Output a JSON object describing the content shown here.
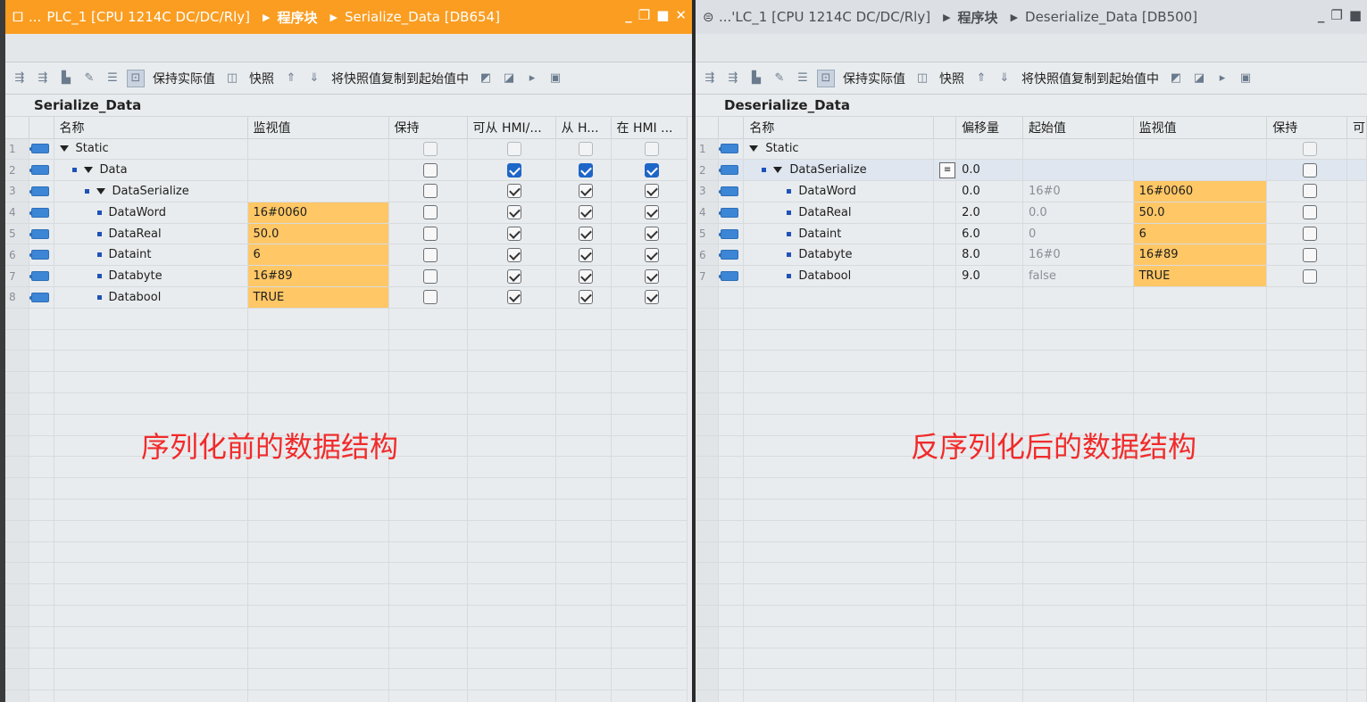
{
  "left": {
    "title": {
      "pin": "🞐",
      "ellipsis": "...",
      "device": "PLC_1 [CPU 1214C DC/DC/Rly]",
      "section": "程序块",
      "block": "Serialize_Data [DB654]",
      "controls": [
        "_",
        "❐",
        "■",
        "✕"
      ]
    },
    "toolbar": {
      "keep_actual": "保持实际值",
      "snapshot": "快照",
      "copy_snapshot": "将快照值复制到起始值中"
    },
    "block_name": "Serialize_Data",
    "columns": [
      "名称",
      "监视值",
      "保持",
      "可从 HMI/...",
      "从 H...",
      "在 HMI ..."
    ],
    "rows": [
      {
        "n": "1",
        "indent": 0,
        "expand": true,
        "dot": false,
        "name": "Static",
        "watch": "",
        "retain": false,
        "hmi1": false,
        "hmi2": false,
        "hmi3": false,
        "dim": true
      },
      {
        "n": "2",
        "indent": 1,
        "expand": true,
        "dot": true,
        "name": "Data",
        "watch": "",
        "retain": false,
        "hmi1": true,
        "hmi2": true,
        "hmi3": true,
        "blue": true
      },
      {
        "n": "3",
        "indent": 2,
        "expand": true,
        "dot": true,
        "name": "DataSerialize",
        "watch": "",
        "retain": false,
        "hmi1": true,
        "hmi2": true,
        "hmi3": true
      },
      {
        "n": "4",
        "indent": 3,
        "expand": false,
        "dot": true,
        "name": "DataWord",
        "watch": "16#0060",
        "retain": false,
        "hmi1": true,
        "hmi2": true,
        "hmi3": true
      },
      {
        "n": "5",
        "indent": 3,
        "expand": false,
        "dot": true,
        "name": "DataReal",
        "watch": "50.0",
        "retain": false,
        "hmi1": true,
        "hmi2": true,
        "hmi3": true
      },
      {
        "n": "6",
        "indent": 3,
        "expand": false,
        "dot": true,
        "name": "Dataint",
        "watch": "6",
        "retain": false,
        "hmi1": true,
        "hmi2": true,
        "hmi3": true
      },
      {
        "n": "7",
        "indent": 3,
        "expand": false,
        "dot": true,
        "name": "Databyte",
        "watch": "16#89",
        "retain": false,
        "hmi1": true,
        "hmi2": true,
        "hmi3": true
      },
      {
        "n": "8",
        "indent": 3,
        "expand": false,
        "dot": true,
        "name": "Databool",
        "watch": "TRUE",
        "retain": false,
        "hmi1": true,
        "hmi2": true,
        "hmi3": true
      }
    ],
    "annotation": "序列化前的数据结构"
  },
  "right": {
    "title": {
      "pin": "⊜",
      "device": "...'LC_1 [CPU 1214C DC/DC/Rly]",
      "section": "程序块",
      "block": "Deserialize_Data [DB500]",
      "controls": [
        "_",
        "❐",
        "■"
      ]
    },
    "toolbar": {
      "keep_actual": "保持实际值",
      "snapshot": "快照",
      "copy_snapshot": "将快照值复制到起始值中"
    },
    "block_name": "Deserialize_Data",
    "columns": [
      "名称",
      "偏移量",
      "起始值",
      "监视值",
      "保持",
      "可"
    ],
    "rows": [
      {
        "n": "1",
        "indent": 0,
        "expand": true,
        "dot": false,
        "name": "Static",
        "offset": "",
        "start": "",
        "watch": "",
        "retain": false,
        "dim": true
      },
      {
        "n": "2",
        "indent": 1,
        "expand": true,
        "dot": true,
        "name": "DataSerialize",
        "offset": "0.0",
        "start": "",
        "watch": "",
        "retain": false,
        "selected": true
      },
      {
        "n": "3",
        "indent": 3,
        "expand": false,
        "dot": true,
        "name": "DataWord",
        "offset": "0.0",
        "start": "16#0",
        "watch": "16#0060",
        "retain": false
      },
      {
        "n": "4",
        "indent": 3,
        "expand": false,
        "dot": true,
        "name": "DataReal",
        "offset": "2.0",
        "start": "0.0",
        "watch": "50.0",
        "retain": false
      },
      {
        "n": "5",
        "indent": 3,
        "expand": false,
        "dot": true,
        "name": "Dataint",
        "offset": "6.0",
        "start": "0",
        "watch": "6",
        "retain": false
      },
      {
        "n": "6",
        "indent": 3,
        "expand": false,
        "dot": true,
        "name": "Databyte",
        "offset": "8.0",
        "start": "16#0",
        "watch": "16#89",
        "retain": false
      },
      {
        "n": "7",
        "indent": 3,
        "expand": false,
        "dot": true,
        "name": "Databool",
        "offset": "9.0",
        "start": "false",
        "watch": "TRUE",
        "retain": false
      }
    ],
    "annotation": "反序列化后的数据结构"
  }
}
